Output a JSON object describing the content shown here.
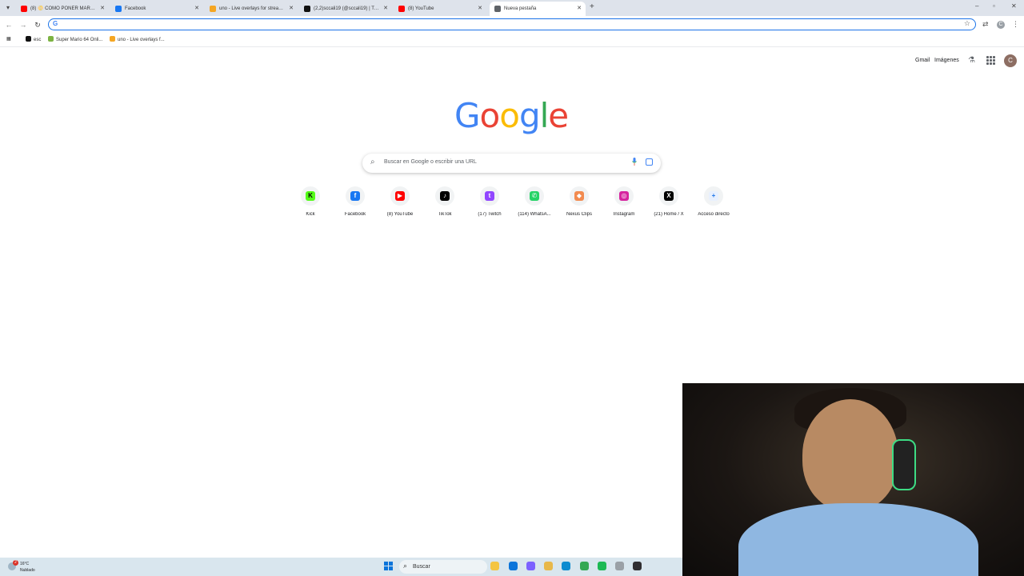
{
  "browser": {
    "tabs": [
      {
        "title": "(8) 📀 COMO PONER MARCAD",
        "favicon_color": "#ff0000",
        "active": false
      },
      {
        "title": "Facebook",
        "favicon_color": "#1877f2",
        "active": false
      },
      {
        "title": "uno - Live overlays for streamin",
        "favicon_color": "#f5a623",
        "active": false
      },
      {
        "title": "(2,2)sccali19 (@sccali19) | TikTok",
        "favicon_color": "#111111",
        "active": false
      },
      {
        "title": "(8) YouTube",
        "favicon_color": "#ff0000",
        "active": false
      },
      {
        "title": "Nueva pestaña",
        "favicon_color": "#5f6368",
        "active": true
      }
    ],
    "omnibox_value": "",
    "profile_initial": "C",
    "bookmarks": [
      {
        "label": "esc",
        "color": "#111111"
      },
      {
        "label": "Super Mario 64 Onli...",
        "color": "#7cb342"
      },
      {
        "label": "uno - Live overlays f...",
        "color": "#f5a623"
      }
    ]
  },
  "page": {
    "top_links": {
      "gmail": "Gmail",
      "images": "Imágenes"
    },
    "avatar_initial": "C",
    "logo_letters": [
      {
        "ch": "G",
        "color": "#4285f4"
      },
      {
        "ch": "o",
        "color": "#ea4335"
      },
      {
        "ch": "o",
        "color": "#fbbc05"
      },
      {
        "ch": "g",
        "color": "#4285f4"
      },
      {
        "ch": "l",
        "color": "#34a853"
      },
      {
        "ch": "e",
        "color": "#ea4335"
      }
    ],
    "search_placeholder": "Buscar en Google o escribir una URL",
    "shortcuts": [
      {
        "label": "Kick",
        "glyph": "K",
        "color": "#53fc18",
        "text_color": "#000000"
      },
      {
        "label": "Facebook",
        "glyph": "f",
        "color": "#1877f2",
        "text_color": "#ffffff"
      },
      {
        "label": "(8) YouTube",
        "glyph": "▶",
        "color": "#ff0000",
        "text_color": "#ffffff"
      },
      {
        "label": "TikTok",
        "glyph": "♪",
        "color": "#000000",
        "text_color": "#ffffff"
      },
      {
        "label": "(17) Twitch",
        "glyph": "t",
        "color": "#9146ff",
        "text_color": "#ffffff"
      },
      {
        "label": "(114) WhatsA...",
        "glyph": "✆",
        "color": "#25d366",
        "text_color": "#ffffff"
      },
      {
        "label": "Nexus Clips",
        "glyph": "◆",
        "color": "#f28b50",
        "text_color": "#ffffff"
      },
      {
        "label": "Instagram",
        "glyph": "◎",
        "color": "#d6249f",
        "text_color": "#ffffff"
      },
      {
        "label": "(21) Home / X",
        "glyph": "X",
        "color": "#000000",
        "text_color": "#ffffff"
      },
      {
        "label": "Acceso directo",
        "glyph": "+",
        "color": "#e8f0fe",
        "text_color": "#1a73e8"
      }
    ]
  },
  "taskbar": {
    "weather_badge": "2",
    "weather_temp": "16°C",
    "weather_condition": "Nublado",
    "search_label": "Buscar",
    "apps": [
      {
        "name": "file-explorer",
        "color": "#f4c542"
      },
      {
        "name": "store",
        "color": "#0a74da"
      },
      {
        "name": "copilot",
        "color": "#7b61ff"
      },
      {
        "name": "folder",
        "color": "#e8b84a"
      },
      {
        "name": "edge",
        "color": "#0c8bd0"
      },
      {
        "name": "chrome",
        "color": "#34a853"
      },
      {
        "name": "spotify",
        "color": "#1db954"
      },
      {
        "name": "app",
        "color": "#9aa0a6"
      },
      {
        "name": "obs",
        "color": "#302e31"
      }
    ]
  }
}
